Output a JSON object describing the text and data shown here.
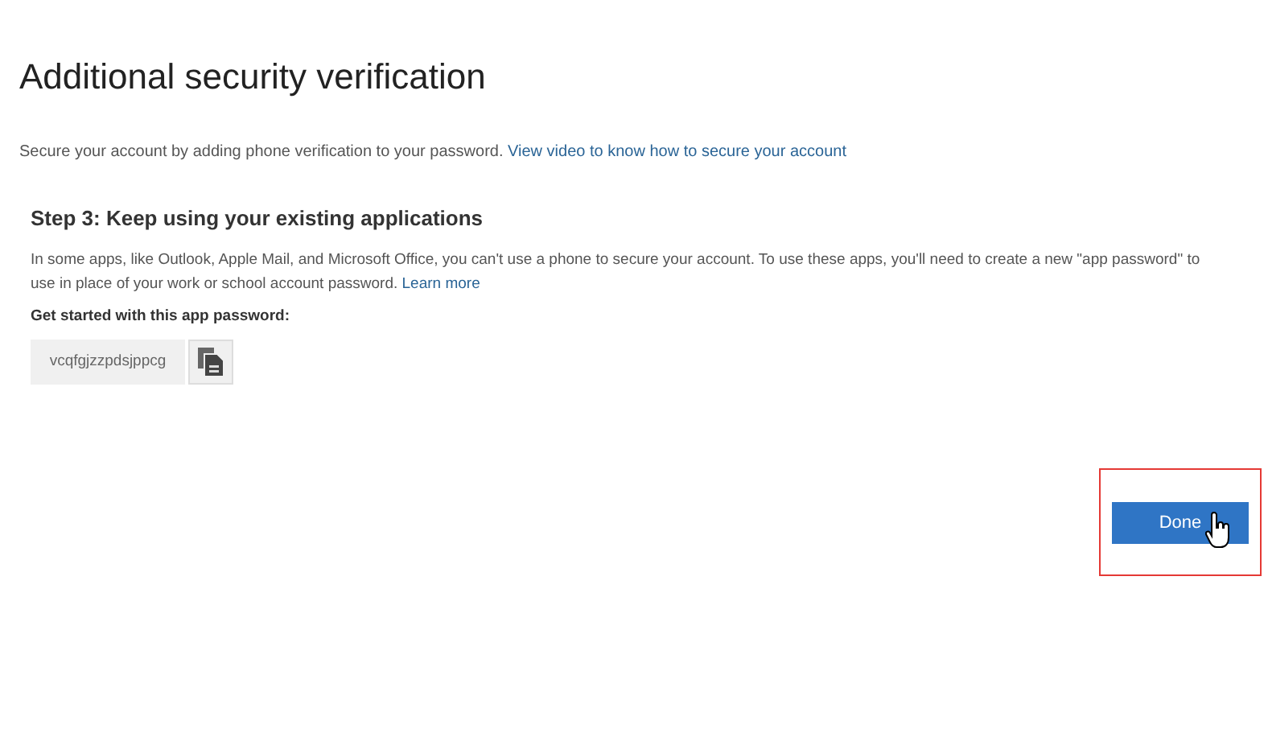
{
  "title": "Additional security verification",
  "intro": {
    "text": "Secure your account by adding phone verification to your password.",
    "link": "View video to know how to secure your account"
  },
  "step": {
    "heading": "Step 3: Keep using your existing applications",
    "text": "In some apps, like Outlook, Apple Mail, and Microsoft Office, you can't use a phone to secure your account. To use these apps, you'll need to create a new \"app password\" to use in place of your work or school account password.",
    "link": "Learn more",
    "label": "Get started with this app password:",
    "password": "vcqfgjzzpdsjppcg"
  },
  "done_button": {
    "label": "Done",
    "highlighted": true
  }
}
